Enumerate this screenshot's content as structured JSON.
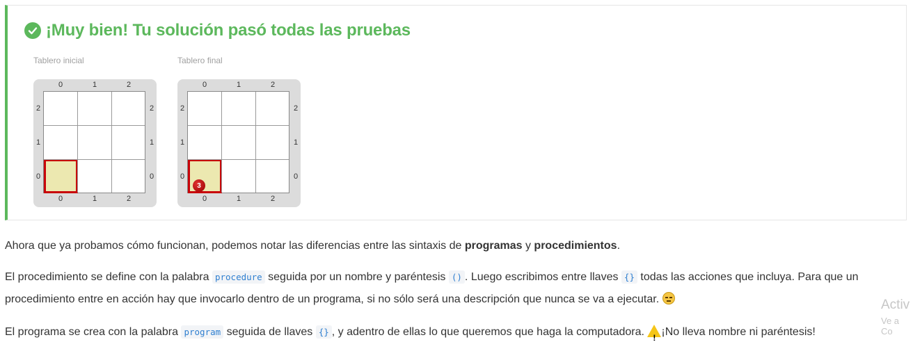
{
  "result": {
    "title": "¡Muy bien! Tu solución pasó todas las pruebas",
    "initial_label": "Tablero inicial",
    "final_label": "Tablero final"
  },
  "board": {
    "col_labels": [
      "0",
      "1",
      "2"
    ],
    "row_labels": [
      "2",
      "1",
      "0"
    ],
    "final_ball_count": "3"
  },
  "paragraphs": {
    "p1": {
      "a": "Ahora que ya probamos cómo funcionan, podemos notar las diferencias entre las sintaxis de ",
      "b": "programas",
      "c": " y ",
      "d": "procedimientos",
      "e": "."
    },
    "p2": {
      "a": "El procedimiento se define con la palabra ",
      "code1": "procedure",
      "b": " seguida por un nombre y paréntesis ",
      "code2": "()",
      "c": ". Luego escribimos entre llaves ",
      "code3": "{}",
      "d": " todas las acciones que incluya. Para que un",
      "e": "procedimiento entre en acción hay que invocarlo dentro de un programa, si no sólo será una descripción que nunca se va a ejecutar. "
    },
    "p3": {
      "a": "El programa se crea con la palabra ",
      "code1": "program",
      "b": " seguida de llaves ",
      "code2": "{}",
      "c": ", y adentro de ellas lo que queremos que haga la computadora. ",
      "d": "¡No lleva nombre ni paréntesis!"
    }
  },
  "watermark": {
    "line1": "Activ",
    "line2": "Ve a Co"
  }
}
